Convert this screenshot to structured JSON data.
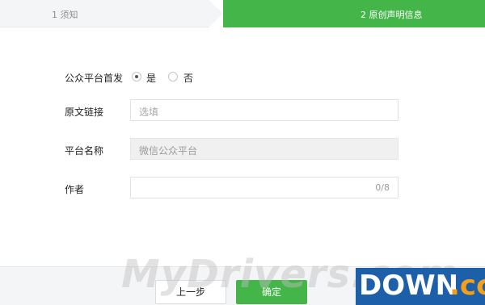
{
  "steps": {
    "step1_label": "1 须知",
    "step2_label": "2 原创声明信息"
  },
  "form": {
    "first_publish": {
      "label": "公众平台首发",
      "options": [
        {
          "label": "是",
          "checked": true
        },
        {
          "label": "否",
          "checked": false
        }
      ]
    },
    "source_link": {
      "label": "原文链接",
      "placeholder": "选填"
    },
    "platform_name": {
      "label": "平台名称",
      "value": "微信公众平台"
    },
    "author": {
      "label": "作者",
      "counter": "0/8"
    }
  },
  "footer": {
    "prev_label": "上一步",
    "ok_label": "确定"
  },
  "watermark": {
    "text": "MyDrivers.com",
    "logo_main": "DOWN",
    "logo_suffix": ".cc"
  },
  "colors": {
    "accent": "#44b549",
    "watermark_logo_bg": "#1d5fa8",
    "watermark_logo_suffix": "#f4a019"
  }
}
